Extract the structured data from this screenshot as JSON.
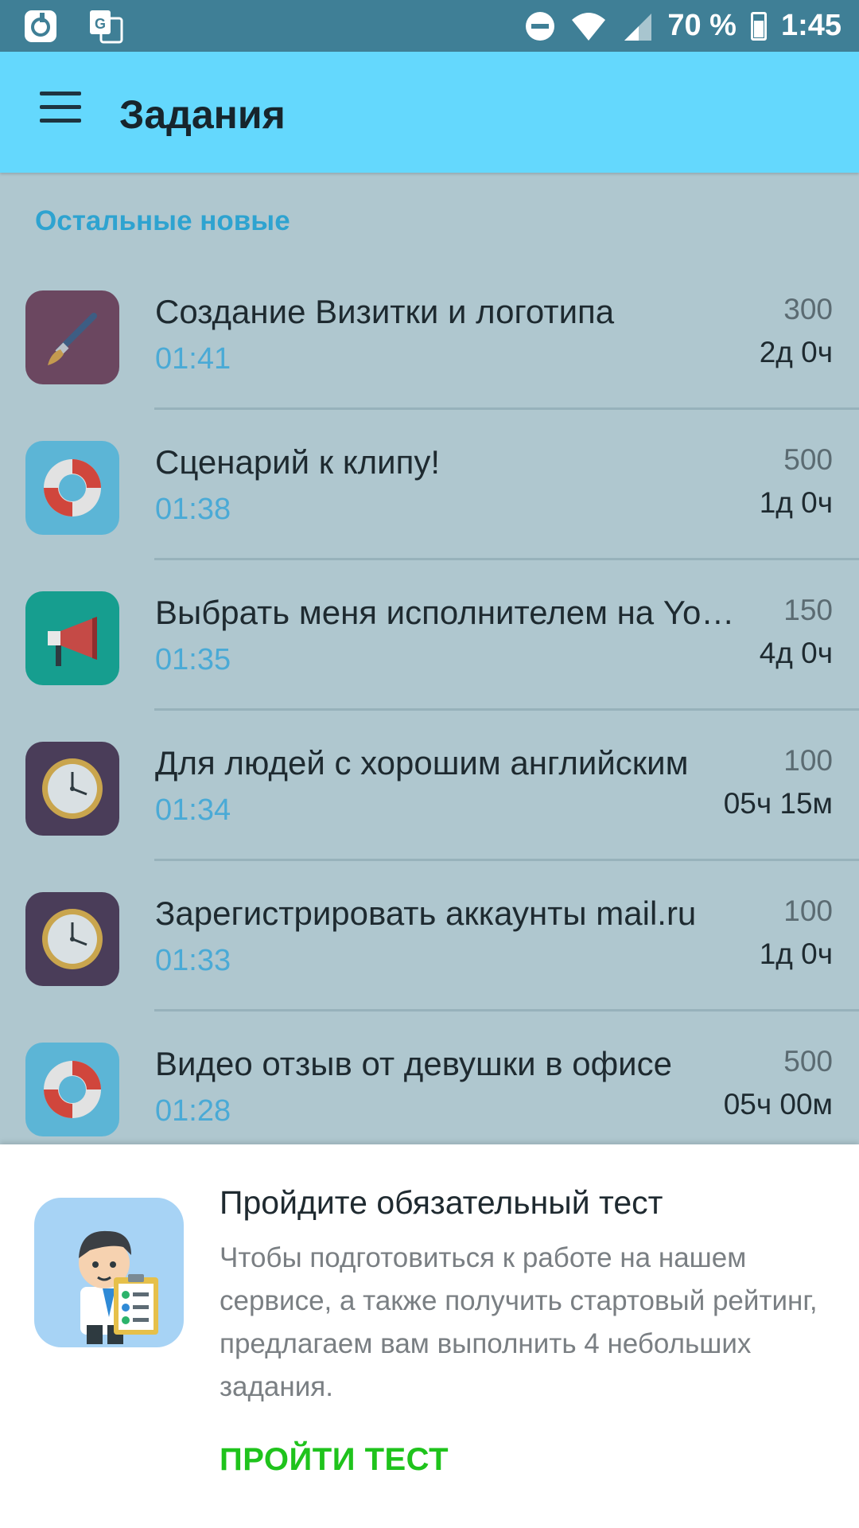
{
  "status_bar": {
    "battery_text": "70 %",
    "clock": "1:45",
    "left_icons": [
      "notification-app-icon",
      "translate-icon"
    ],
    "right_icons": [
      "do-not-disturb-icon",
      "wifi-icon",
      "signal-icon",
      "battery-icon"
    ]
  },
  "app_bar": {
    "title": "Задания",
    "menu_icon": "hamburger-menu-icon",
    "color": "#64d8fd"
  },
  "section": {
    "title": "Остальные новые"
  },
  "tasks": [
    {
      "title": "Создание Визитки и логотипа",
      "time": "01:41",
      "price": "300",
      "deadline": "2д 0ч",
      "icon": "brush-icon",
      "icon_bg": "#6b4760"
    },
    {
      "title": "Сценарий к клипу!",
      "time": "01:38",
      "price": "500",
      "deadline": "1д 0ч",
      "icon": "lifebuoy-icon",
      "icon_bg": "#5cb5d6"
    },
    {
      "title": "Выбрать меня исполнителем на Yo…",
      "time": "01:35",
      "price": "150",
      "deadline": "4д 0ч",
      "icon": "megaphone-icon",
      "icon_bg": "#169e8f"
    },
    {
      "title": "Для людей с хорошим английским",
      "time": "01:34",
      "price": "100",
      "deadline": "05ч 15м",
      "icon": "clock-icon",
      "icon_bg": "#4a3d59"
    },
    {
      "title": "Зарегистрировать аккаунты mail.ru",
      "time": "01:33",
      "price": "100",
      "deadline": "1д 0ч",
      "icon": "clock-icon",
      "icon_bg": "#4a3d59"
    },
    {
      "title": "Видео отзыв от девушки в офисе",
      "time": "01:28",
      "price": "500",
      "deadline": "05ч 00м",
      "icon": "lifebuoy-icon",
      "icon_bg": "#5cb5d6"
    }
  ],
  "test_prompt": {
    "title": "Пройдите обязательный тест",
    "body": "Чтобы подготовиться к работе на нашем сервисе, а также получить стартовый рейтинг, предлагаем вам выполнить 4 небольших задания.",
    "button": "ПРОЙТИ ТЕСТ",
    "illustration": "businessman-checklist-illustration",
    "button_color": "#1fc31c"
  }
}
